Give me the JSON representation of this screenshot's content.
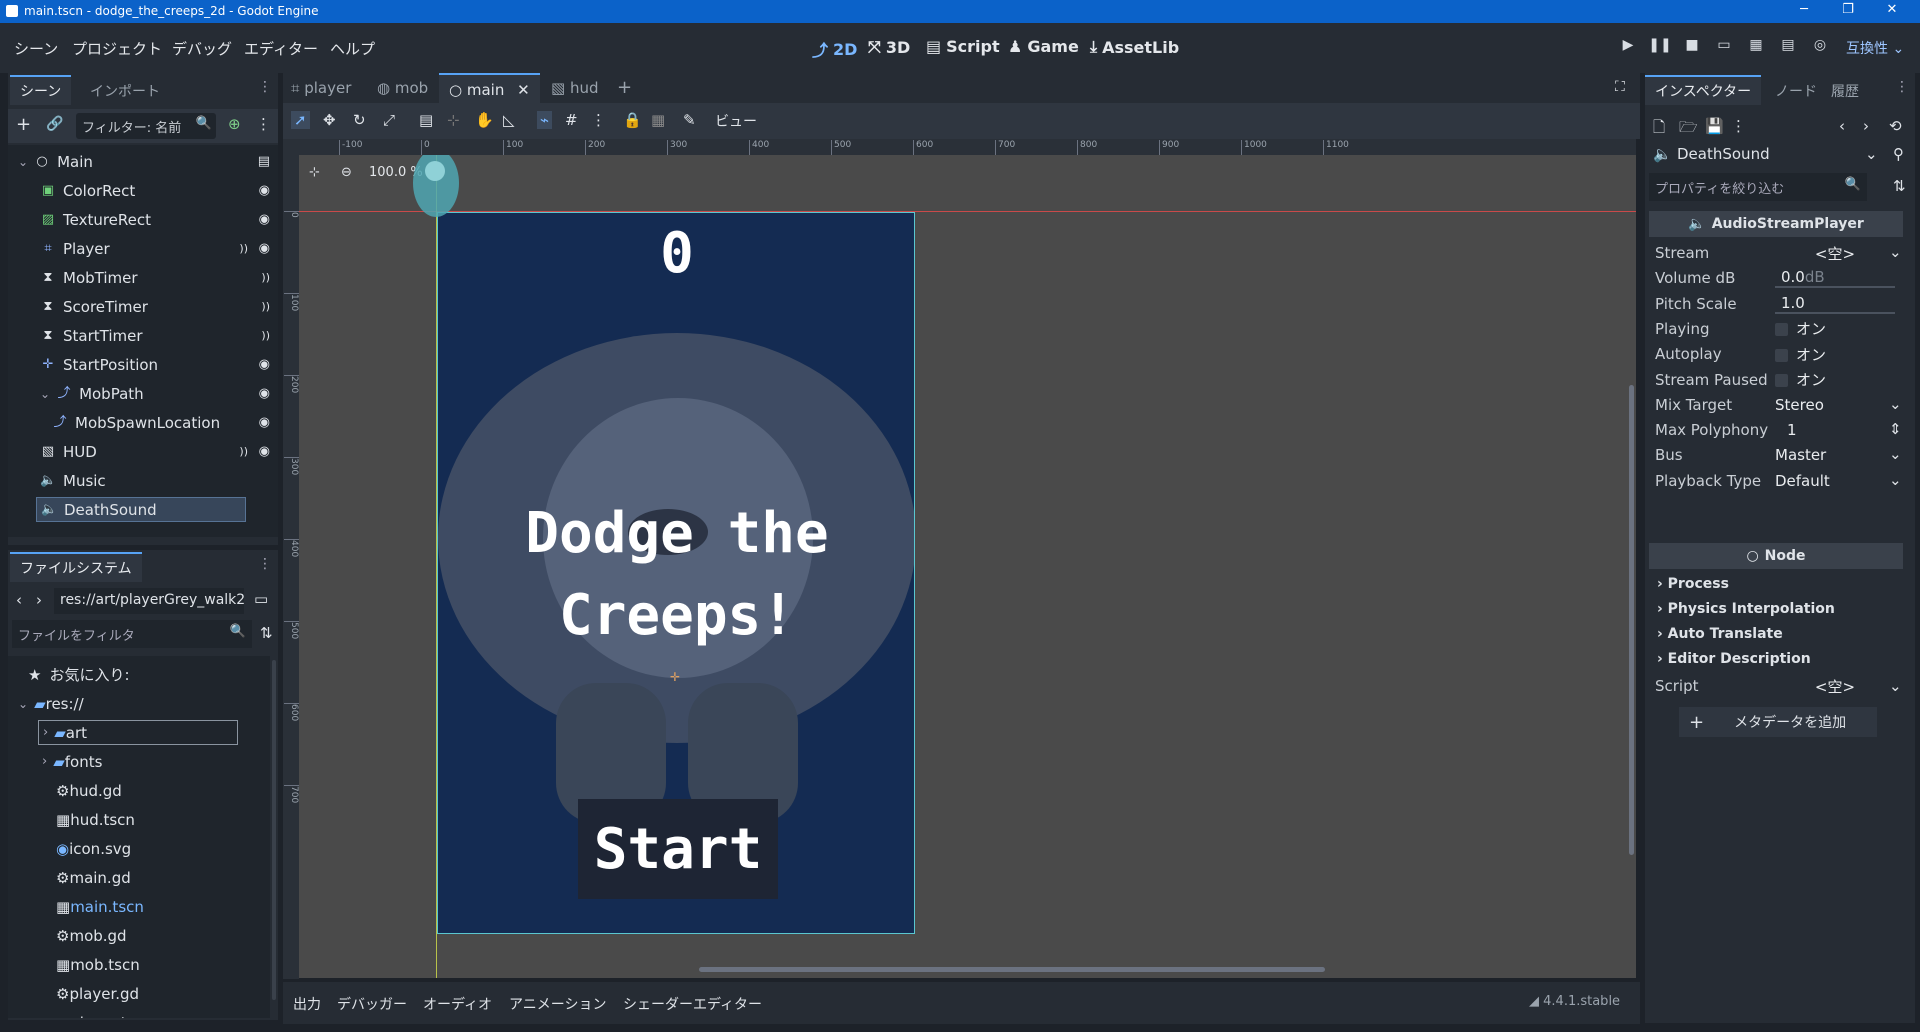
{
  "titlebar": {
    "title": "main.tscn - dodge_the_creeps_2d - Godot Engine",
    "minimize": "─",
    "maximize": "❐",
    "close": "✕"
  },
  "menu": [
    "シーン",
    "プロジェクト",
    "デバッグ",
    "エディター",
    "ヘルプ"
  ],
  "workspaces": [
    {
      "label": "2D",
      "icon": "2d-icon"
    },
    {
      "label": "3D",
      "icon": "3d-icon"
    },
    {
      "label": "Script",
      "icon": "script-icon"
    },
    {
      "label": "Game",
      "icon": "game-icon"
    },
    {
      "label": "AssetLib",
      "icon": "assetlib-icon"
    }
  ],
  "compat_label": "互換性",
  "scene_dock": {
    "tabs": [
      "シーン",
      "インポート"
    ],
    "filter_placeholder": "フィルター: 名前",
    "nodes": [
      {
        "name": "Main",
        "icon": "○",
        "depth": 0
      },
      {
        "name": "ColorRect",
        "icon": "▣",
        "depth": 1
      },
      {
        "name": "TextureRect",
        "icon": "▨",
        "depth": 1
      },
      {
        "name": "Player",
        "icon": "⌗",
        "depth": 1
      },
      {
        "name": "MobTimer",
        "icon": "⧗",
        "depth": 1
      },
      {
        "name": "ScoreTimer",
        "icon": "⧗",
        "depth": 1
      },
      {
        "name": "StartTimer",
        "icon": "⧗",
        "depth": 1
      },
      {
        "name": "StartPosition",
        "icon": "✛",
        "depth": 1
      },
      {
        "name": "MobPath",
        "icon": "⤴",
        "depth": 1
      },
      {
        "name": "MobSpawnLocation",
        "icon": "⤴",
        "depth": 2
      },
      {
        "name": "HUD",
        "icon": "▧",
        "depth": 1
      },
      {
        "name": "Music",
        "icon": "🔈",
        "depth": 1
      },
      {
        "name": "DeathSound",
        "icon": "🔈",
        "depth": 1
      }
    ]
  },
  "filesystem": {
    "tab": "ファイルシステム",
    "path": "res://art/playerGrey_walk2",
    "filter_placeholder": "ファイルをフィルタ",
    "favorites": "お気に入り:",
    "items": [
      {
        "name": "res://",
        "icon": "folder",
        "depth": 0
      },
      {
        "name": "art",
        "icon": "folder",
        "depth": 1
      },
      {
        "name": "fonts",
        "icon": "folder",
        "depth": 1
      },
      {
        "name": "hud.gd",
        "icon": "gear",
        "depth": 1
      },
      {
        "name": "hud.tscn",
        "icon": "scene",
        "depth": 1
      },
      {
        "name": "icon.svg",
        "icon": "image",
        "depth": 1
      },
      {
        "name": "main.gd",
        "icon": "gear",
        "depth": 1
      },
      {
        "name": "main.tscn",
        "icon": "scene",
        "depth": 1
      },
      {
        "name": "mob.gd",
        "icon": "gear",
        "depth": 1
      },
      {
        "name": "mob.tscn",
        "icon": "scene",
        "depth": 1
      },
      {
        "name": "player.gd",
        "icon": "gear",
        "depth": 1
      },
      {
        "name": "player.tscn",
        "icon": "scene",
        "depth": 1
      }
    ]
  },
  "editor_tabs": [
    "player",
    "mob",
    "main",
    "hud"
  ],
  "toolbar": {
    "view_label": "ビュー",
    "zoom": "100.0 %"
  },
  "ruler_labels": [
    "-100",
    "0",
    "100",
    "200",
    "300",
    "400",
    "500",
    "600",
    "700",
    "800",
    "900",
    "1000",
    "1100"
  ],
  "ruler_vlabels": [
    "0",
    "100",
    "200",
    "300",
    "400",
    "500",
    "600",
    "700"
  ],
  "game": {
    "score": "0",
    "message": "Dodge the Creeps!",
    "start_button": "Start"
  },
  "bottom_panel": {
    "tabs": [
      "出力",
      "デバッガー",
      "オーディオ",
      "アニメーション",
      "シェーダーエディター"
    ],
    "version": "4.4.1.stable"
  },
  "inspector": {
    "tabs": [
      "インスペクター",
      "ノード",
      "履歴"
    ],
    "node_name": "DeathSound",
    "filter_placeholder": "プロパティを絞り込む",
    "class_name": "AudioStreamPlayer",
    "properties": [
      {
        "key": "Stream",
        "value": "<空>"
      },
      {
        "key": "Volume dB",
        "value": "0.0",
        "unit": "dB"
      },
      {
        "key": "Pitch Scale",
        "value": "1.0"
      },
      {
        "key": "Playing",
        "value": "オン",
        "checkbox": true
      },
      {
        "key": "Autoplay",
        "value": "オン",
        "checkbox": true
      },
      {
        "key": "Stream Paused",
        "value": "オン",
        "checkbox": true
      },
      {
        "key": "Mix Target",
        "value": "Stereo"
      },
      {
        "key": "Max Polyphony",
        "value": "1"
      },
      {
        "key": "Bus",
        "value": "Master"
      },
      {
        "key": "Playback Type",
        "value": "Default"
      }
    ],
    "node_section": "Node",
    "groups": [
      "Process",
      "Physics Interpolation",
      "Auto Translate",
      "Editor Description"
    ],
    "script_key": "Script",
    "script_value": "<空>",
    "add_metadata": "メタデータを追加"
  },
  "colors": {
    "accent": "#57a3f5",
    "title_bar": "#0b62c9",
    "game_bg": "#142b52",
    "canvas": "#4a4a4a"
  }
}
